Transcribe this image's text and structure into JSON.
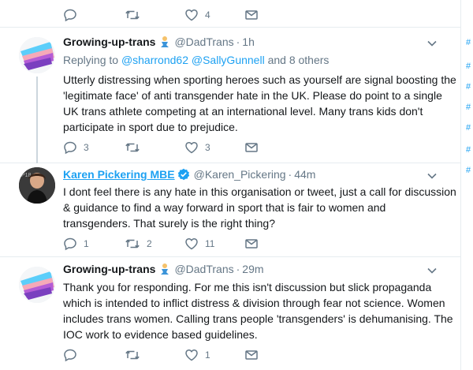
{
  "top_actions": {
    "reply_count": "",
    "retweet_count": "",
    "like_count": "4"
  },
  "tweets": [
    {
      "display_name": "Growing-up-trans",
      "handle": "@DadTrans",
      "time": "1h",
      "reply_prefix": "Replying to",
      "reply_mention_1": "@sharrond62",
      "reply_mention_2": "@SallyGunnell",
      "reply_suffix": "and 8 others",
      "lines": [
        "Utterly distressing when sporting heroes such as yourself are signal boosting the",
        "'legitimate face' of anti transgender hate in the UK. Please do point to a single",
        "UK trans athlete competing at an international level. Many trans kids don't",
        "participate in sport due to prejudice."
      ],
      "reply_count": "3",
      "retweet_count": "",
      "like_count": "3"
    },
    {
      "display_name": "Karen Pickering MBE",
      "handle": "@Karen_Pickering",
      "time": "44m",
      "lines": [
        "I dont feel there is any hate in this organisation or tweet, just a call for discussion",
        "& guidance to find a way forward in sport that is fair to women and",
        "transgenders. That surely is the right thing?"
      ],
      "reply_count": "1",
      "retweet_count": "2",
      "like_count": "11"
    },
    {
      "display_name": "Growing-up-trans",
      "handle": "@DadTrans",
      "time": "29m",
      "lines": [
        "Thank you for responding. For me this isn't discussion but slick propaganda",
        "which is intended to inflict distress & division through fear not science. Women",
        "includes trans women. Calling trans people 'transgenders' is dehumanising. The",
        "IOC work to evidence based guidelines."
      ],
      "reply_count": "",
      "retweet_count": "",
      "like_count": "1"
    }
  ],
  "side_fragments": [
    "#",
    "#",
    "#",
    "#",
    "#",
    "#",
    "#"
  ],
  "colors": {
    "link_blue": "#1da1f2",
    "muted_gray": "#657786",
    "divider": "#e6ecf0",
    "thread_line": "#ccd6dd",
    "verified_blue": "#1da1f2"
  },
  "icons": {
    "reply": "reply-icon",
    "retweet": "retweet-icon",
    "like": "heart-icon",
    "dm": "envelope-icon",
    "caret": "chevron-down-icon",
    "emoji": "merperson-emoji-icon",
    "verified": "verified-badge-icon"
  }
}
